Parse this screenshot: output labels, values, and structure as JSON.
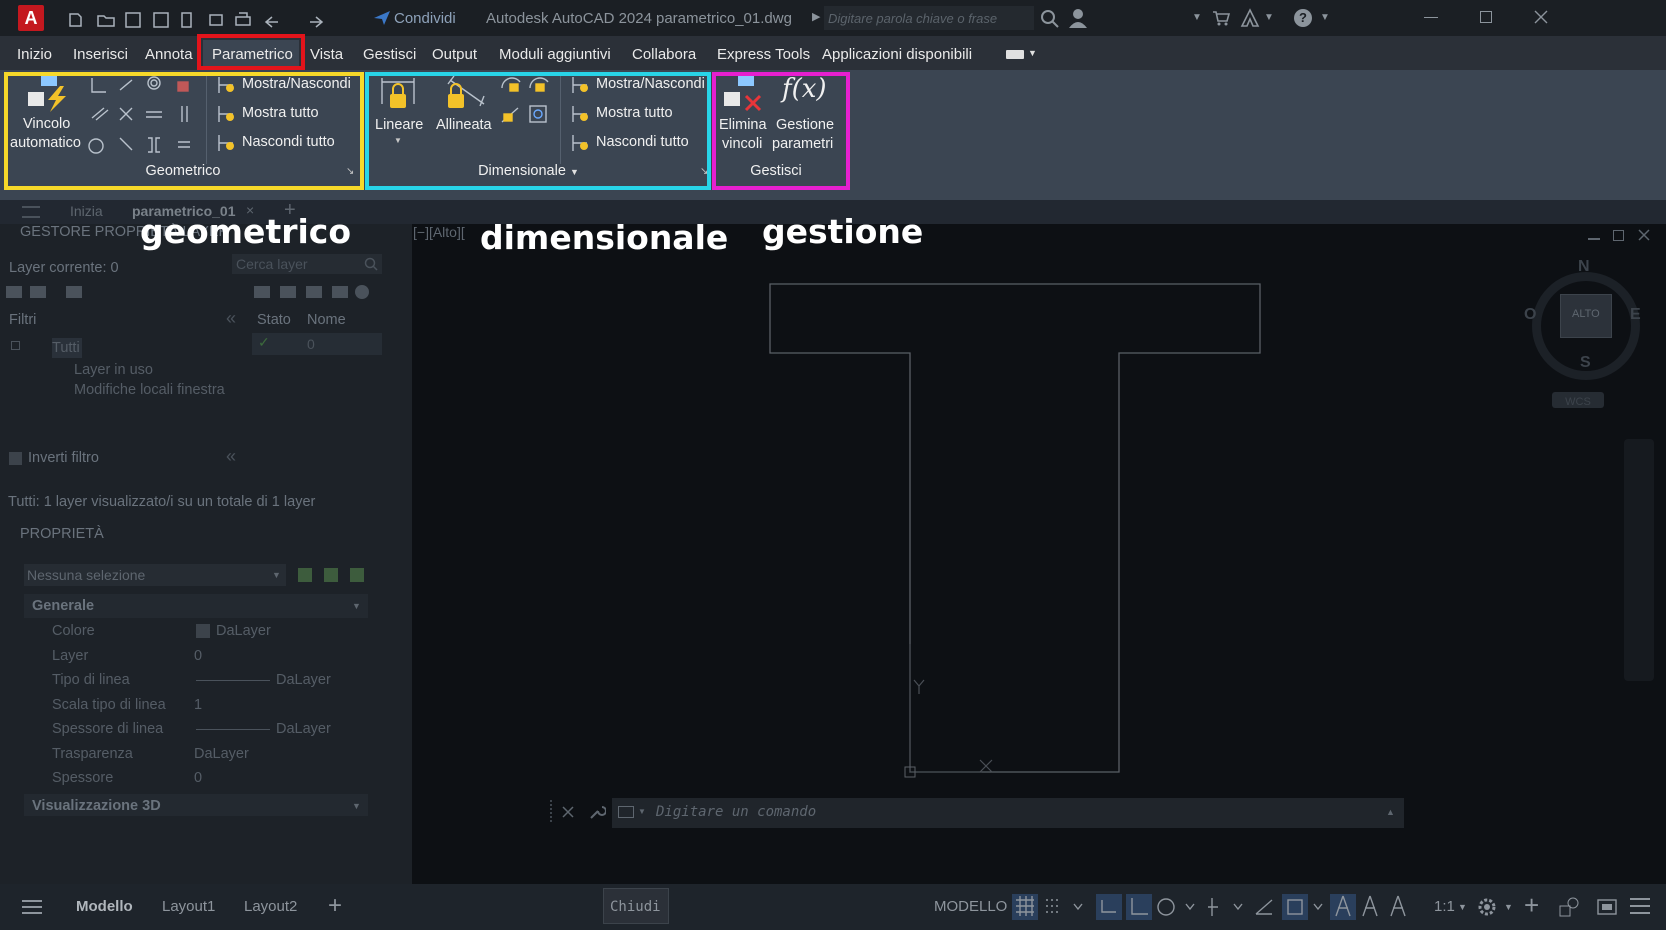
{
  "titlebar": {
    "share_label": "Condividi",
    "app_title": "Autodesk AutoCAD 2024",
    "file_name": "parametrico_01.dwg",
    "search_placeholder": "Digitare parola chiave o frase"
  },
  "menu": {
    "tabs": [
      "Inizio",
      "Inserisci",
      "Annota",
      "Parametrico",
      "Vista",
      "Gestisci",
      "Output",
      "Moduli aggiuntivi",
      "Collabora",
      "Express Tools",
      "Applicazioni disponibili"
    ],
    "active_tab": "Parametrico"
  },
  "ribbon": {
    "geometrico": {
      "auto_line1": "Vincolo",
      "auto_line2": "automatico",
      "show_hide": "Mostra/Nascondi",
      "show_all": "Mostra tutto",
      "hide_all": "Nascondi tutto",
      "title": "Geometrico"
    },
    "dimensionale": {
      "linear": "Lineare",
      "aligned": "Allineata",
      "show_hide": "Mostra/Nascondi",
      "show_all": "Mostra tutto",
      "hide_all": "Nascondi tutto",
      "title": "Dimensionale"
    },
    "gestisci": {
      "delete_line1": "Elimina",
      "delete_line2": "vincoli",
      "params_line1": "Gestione",
      "params_line2": "parametri",
      "fx_label": "f(x)",
      "title": "Gestisci"
    },
    "colors": {
      "geometrico": "#f7d92a",
      "dimensionale": "#28d4e8",
      "gestisci": "#e61fcf",
      "active_tab": "#e3141b"
    }
  },
  "annotations": {
    "geometrico": "geometrico",
    "dimensionale": "dimensionale",
    "gestione": "gestione"
  },
  "doctabs": {
    "start": "Inizia",
    "drawing": "parametrico_01"
  },
  "layers": {
    "title": "GESTORE PROPRIETÀ LAYER",
    "current": "Layer corrente: 0",
    "search_placeholder": "Cerca layer",
    "filters_label": "Filtri",
    "col_state": "Stato",
    "col_name": "Nome",
    "row_name": "0",
    "tree_all": "Tutti",
    "tree_in_use": "Layer in uso",
    "tree_local": "Modifiche locali finestra",
    "invert": "Inverti filtro",
    "summary": "Tutti: 1 layer visualizzato/i su un totale di 1 layer"
  },
  "properties": {
    "title": "PROPRIETÀ",
    "selection": "Nessuna selezione",
    "section_general": "Generale",
    "rows": [
      {
        "label": "Colore",
        "value": "DaLayer"
      },
      {
        "label": "Layer",
        "value": "0"
      },
      {
        "label": "Tipo di linea",
        "value": "DaLayer"
      },
      {
        "label": "Scala tipo di linea",
        "value": "1"
      },
      {
        "label": "Spessore di linea",
        "value": "DaLayer"
      },
      {
        "label": "Trasparenza",
        "value": "DaLayer"
      },
      {
        "label": "Spessore",
        "value": "0"
      }
    ],
    "section_3d": "Visualizzazione 3D"
  },
  "viewport": {
    "label": "[−][Alto][",
    "compass": {
      "n": "N",
      "s": "S",
      "e": "E",
      "o": "O",
      "center": "ALTO"
    },
    "wcs": "WCS"
  },
  "command": {
    "placeholder": "Digitare un comando"
  },
  "statusbar": {
    "layouts": [
      "Modello",
      "Layout1",
      "Layout2"
    ],
    "close_tooltip": "Chiudi",
    "model_label": "MODELLO",
    "scale": "1:1"
  }
}
